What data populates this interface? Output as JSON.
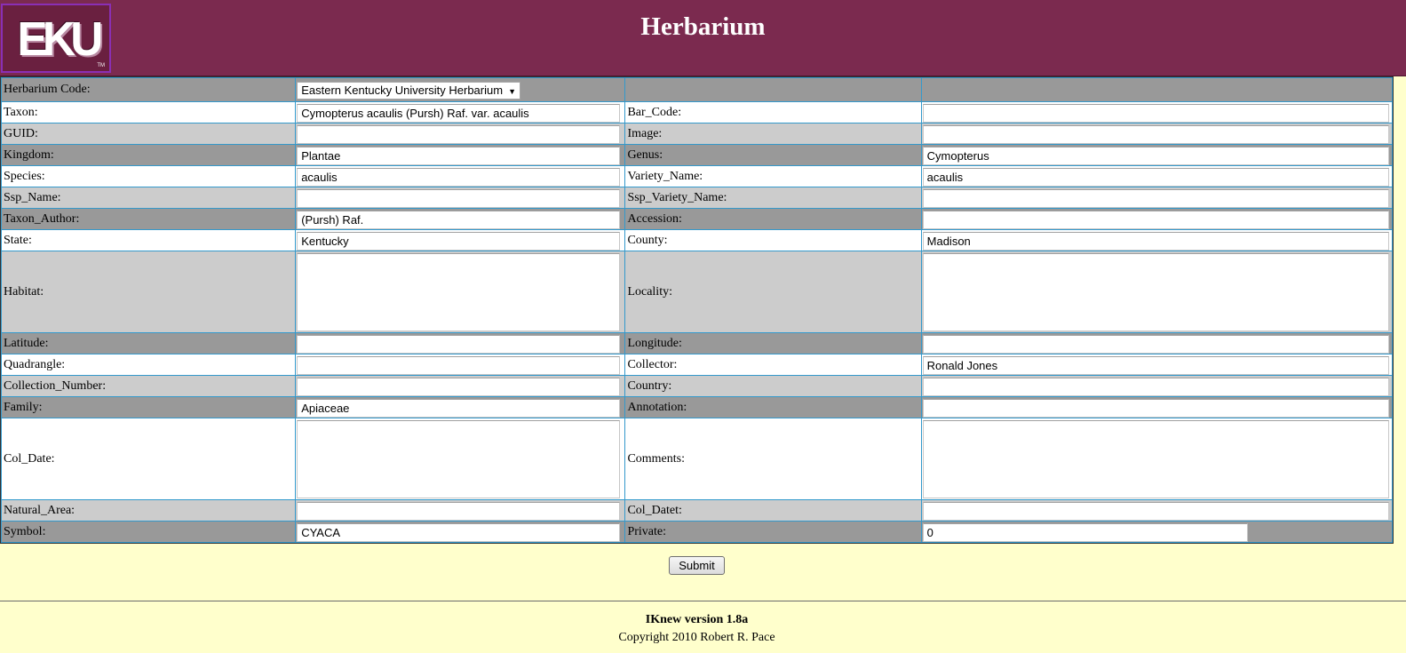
{
  "header": {
    "logo_text": "EKU",
    "logo_tm": "TM",
    "title": "Herbarium",
    "color": "#7b2a4f"
  },
  "form": {
    "herbarium_code": {
      "label": "Herbarium Code:",
      "selected": "Eastern Kentucky University Herbarium"
    },
    "taxon": {
      "label": "Taxon:",
      "value": "Cymopterus acaulis (Pursh) Raf. var. acaulis"
    },
    "bar_code": {
      "label": "Bar_Code:",
      "value": ""
    },
    "guid": {
      "label": "GUID:",
      "value": ""
    },
    "image": {
      "label": "Image:",
      "value": ""
    },
    "kingdom": {
      "label": "Kingdom:",
      "value": "Plantae"
    },
    "genus": {
      "label": "Genus:",
      "value": "Cymopterus"
    },
    "species": {
      "label": "Species:",
      "value": "acaulis"
    },
    "variety_name": {
      "label": "Variety_Name:",
      "value": "acaulis"
    },
    "ssp_name": {
      "label": "Ssp_Name:",
      "value": ""
    },
    "ssp_variety_name": {
      "label": "Ssp_Variety_Name:",
      "value": ""
    },
    "taxon_author": {
      "label": "Taxon_Author:",
      "value": "(Pursh) Raf."
    },
    "accession": {
      "label": "Accession:",
      "value": ""
    },
    "state": {
      "label": "State:",
      "value": "Kentucky"
    },
    "county": {
      "label": "County:",
      "value": "Madison"
    },
    "habitat": {
      "label": "Habitat:",
      "value": ""
    },
    "locality": {
      "label": "Locality:",
      "value": ""
    },
    "latitude": {
      "label": "Latitude:",
      "value": ""
    },
    "longitude": {
      "label": "Longitude:",
      "value": ""
    },
    "quadrangle": {
      "label": "Quadrangle:",
      "value": ""
    },
    "collector": {
      "label": "Collector:",
      "value": "Ronald Jones"
    },
    "collection_number": {
      "label": "Collection_Number:",
      "value": ""
    },
    "country": {
      "label": "Country:",
      "value": ""
    },
    "family": {
      "label": "Family:",
      "value": "Apiaceae"
    },
    "annotation": {
      "label": "Annotation:",
      "value": ""
    },
    "col_date": {
      "label": "Col_Date:",
      "value": ""
    },
    "comments": {
      "label": "Comments:",
      "value": ""
    },
    "natural_area": {
      "label": "Natural_Area:",
      "value": ""
    },
    "col_datet": {
      "label": "Col_Datet:",
      "value": ""
    },
    "symbol": {
      "label": "Symbol:",
      "value": "CYACA"
    },
    "private": {
      "label": "Private:",
      "value": "0"
    }
  },
  "submit_label": "Submit",
  "footer": {
    "version": "IKnew version 1.8a",
    "copyright": "Copyright 2010 Robert R. Pace"
  }
}
